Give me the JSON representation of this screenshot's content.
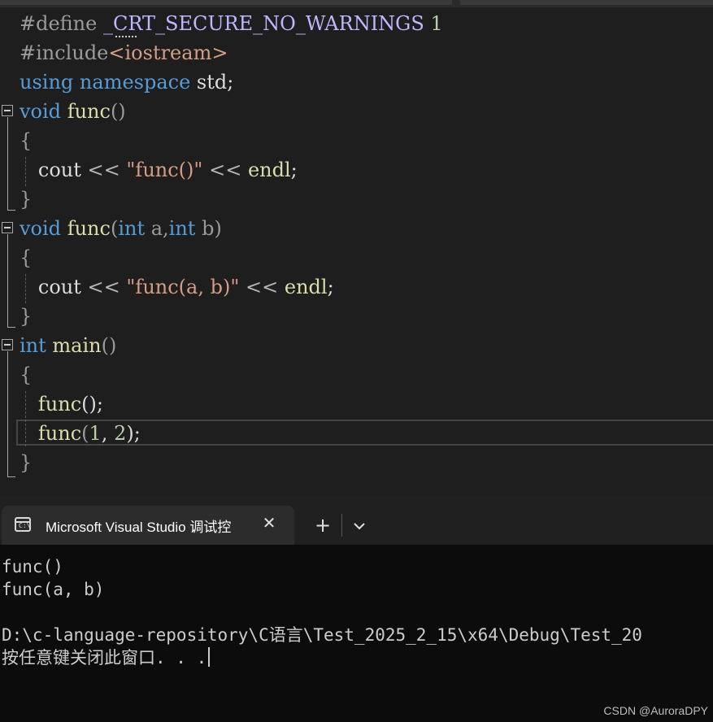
{
  "editor": {
    "lines": {
      "l1": {
        "directive": "#define",
        "macro": "_CRT_SECURE_NO_WARNINGS",
        "value": "1"
      },
      "l2": {
        "directive": "#include",
        "header": "<iostream>"
      },
      "l3": {
        "kw1": "using",
        "kw2": "namespace",
        "ns": "std;"
      },
      "l4": {
        "type": "void",
        "name": "func",
        "parens": "()"
      },
      "l5": {
        "brace": "{"
      },
      "l6": {
        "obj": "cout",
        "op1": "<<",
        "str": "\"func()\"",
        "op2": "<<",
        "endl": "endl",
        "semi": ";"
      },
      "l7": {
        "brace": "}"
      },
      "l8": {
        "type": "void",
        "name": "func",
        "open": "(",
        "t1": "int",
        "p1": "a,",
        "t2": "int",
        "p2": "b",
        "close": ")"
      },
      "l9": {
        "brace": "{"
      },
      "l10": {
        "obj": "cout",
        "op1": "<<",
        "str": "\"func(a, b)\"",
        "op2": "<<",
        "endl": "endl",
        "semi": ";"
      },
      "l11": {
        "brace": "}"
      },
      "l12": {
        "type": "int",
        "name": "main",
        "parens": "()"
      },
      "l13": {
        "brace": "{"
      },
      "l14": {
        "name": "func",
        "rest": "();"
      },
      "l15": {
        "name": "func",
        "open": "(",
        "a1": "1",
        "comma": ", ",
        "a2": "2",
        "close": ");"
      },
      "l16": {
        "brace": "}"
      }
    }
  },
  "terminal": {
    "tab_title": "Microsoft Visual Studio 调试控",
    "tab_icon": "cmd-icon",
    "close_glyph": "✕",
    "new_tab_glyph": "+",
    "output": [
      "func()",
      "func(a, b)",
      "",
      "D:\\c-language-repository\\C语言\\Test_2025_2_15\\x64\\Debug\\Test_20",
      "按任意键关闭此窗口. . ."
    ],
    "watermark": "CSDN @AuroraDPY"
  },
  "colors": {
    "editor_bg": "#1e1e1e",
    "keyword": "#569cd6",
    "function": "#dcdcaa",
    "string": "#d69d85",
    "number": "#b5cea8",
    "macro": "#beb7ff",
    "terminal_bg": "#0c0c0c"
  }
}
